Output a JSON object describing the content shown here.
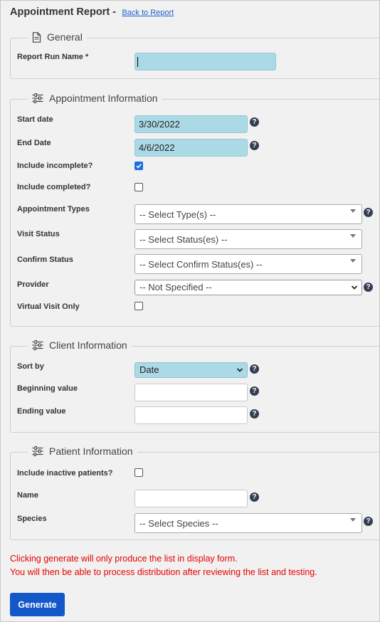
{
  "header": {
    "title": "Appointment Report -",
    "back_link": "Back to Report"
  },
  "general": {
    "legend": "General",
    "icon": "document-icon",
    "report_run_name_label": "Report Run Name *",
    "report_run_name_value": ""
  },
  "appointment": {
    "legend": "Appointment Information",
    "icon": "sliders-icon",
    "start_date_label": "Start date",
    "start_date_value": "3/30/2022",
    "end_date_label": "End Date",
    "end_date_value": "4/6/2022",
    "include_incomplete_label": "Include incomplete?",
    "include_incomplete_checked": true,
    "include_completed_label": "Include completed?",
    "include_completed_checked": false,
    "appointment_types_label": "Appointment Types",
    "appointment_types_value": "-- Select Type(s) --",
    "visit_status_label": "Visit Status",
    "visit_status_value": "-- Select Status(es) --",
    "confirm_status_label": "Confirm Status",
    "confirm_status_value": "-- Select Confirm Status(es) --",
    "provider_label": "Provider",
    "provider_value": "-- Not Specified --",
    "virtual_visit_label": "Virtual Visit Only",
    "virtual_visit_checked": false
  },
  "client": {
    "legend": "Client Information",
    "icon": "sliders-icon",
    "sort_by_label": "Sort by",
    "sort_by_value": "Date",
    "beginning_value_label": "Beginning value",
    "beginning_value": "",
    "ending_value_label": "Ending value",
    "ending_value": ""
  },
  "patient": {
    "legend": "Patient Information",
    "icon": "sliders-icon",
    "include_inactive_label": "Include inactive patients?",
    "include_inactive_checked": false,
    "name_label": "Name",
    "name_value": "",
    "species_label": "Species",
    "species_value": "-- Select Species --"
  },
  "notice": {
    "line1": "Clicking generate will only produce the list in display form.",
    "line2": "You will then be able to process distribution after reviewing the list and testing.",
    "color": "#e60000"
  },
  "actions": {
    "generate_label": "Generate"
  },
  "help_glyph": "?",
  "colors": {
    "accent": "#1457c8",
    "highlight_field": "#acd9e6",
    "help_icon": "#333e52"
  }
}
